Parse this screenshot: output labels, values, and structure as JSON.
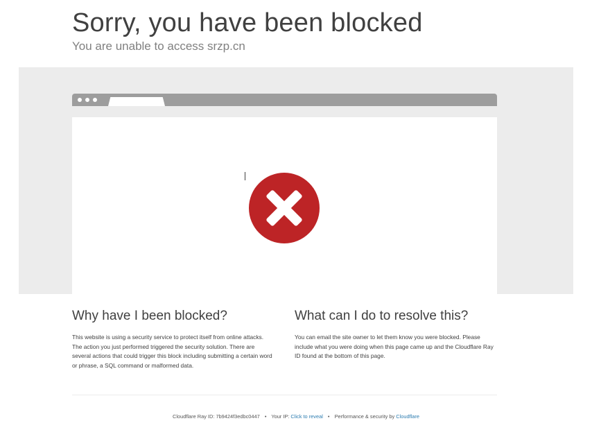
{
  "header": {
    "title": "Sorry, you have been blocked",
    "subtitle": "You are unable to access srzp.cn"
  },
  "illustration": {
    "icon": "error-x-icon",
    "icon_color": "#bd2426",
    "bar_color": "#9d9d9d",
    "background_color": "#ececec"
  },
  "why": {
    "heading": "Why have I been blocked?",
    "text": "This website is using a security service to protect itself from online attacks. The action you just performed triggered the security solution. There are several actions that could trigger this block including submitting a certain word or phrase, a SQL command or malformed data."
  },
  "resolve": {
    "heading": "What can I do to resolve this?",
    "text": "You can email the site owner to let them know you were blocked. Please include what you were doing when this page came up and the Cloudflare Ray ID found at the bottom of this page."
  },
  "footer": {
    "ray_label": "Cloudflare Ray ID:",
    "ray_id": "7b9424f3edbc0447",
    "separator": "•",
    "ip_label": "Your IP:",
    "ip_link": "Click to reveal",
    "perf_label": "Performance & security by",
    "cloudflare_link": "Cloudflare",
    "link_color": "#2c7cb0"
  }
}
